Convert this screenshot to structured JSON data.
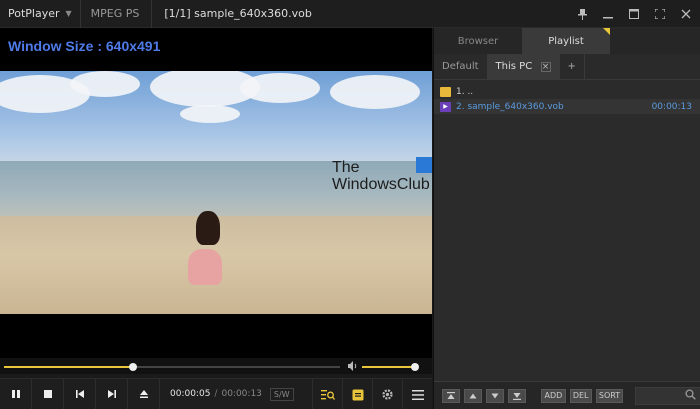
{
  "titlebar": {
    "app_name": "PotPlayer",
    "format": "MPEG PS",
    "file_title": "[1/1] sample_640x360.vob"
  },
  "video": {
    "osd_text": "Window Size : 640x491",
    "watermark_line1": "The",
    "watermark_line2": "WindowsClub"
  },
  "seek": {
    "progress_fraction": 0.385,
    "volume_fraction": 0.95
  },
  "controls": {
    "current_time": "00:00:05",
    "separator": "/",
    "total_time": "00:00:13",
    "sw_label": "S/W"
  },
  "panel": {
    "tabs": [
      {
        "label": "Browser",
        "active": false
      },
      {
        "label": "Playlist",
        "active": true
      }
    ],
    "subtabs": [
      {
        "label": "Default"
      },
      {
        "label": "This PC"
      }
    ],
    "plus_label": "+",
    "items": [
      {
        "label": "1. ..",
        "type": "folder",
        "duration": ""
      },
      {
        "label": "2. sample_640x360.vob",
        "type": "video",
        "duration": "00:00:13"
      }
    ],
    "buttons": {
      "add": "ADD",
      "del": "DEL",
      "sort": "SORT"
    }
  },
  "colors": {
    "accent": "#e8c53a",
    "osd_blue": "#4f7be8",
    "selected_text": "#5b9bdf"
  }
}
